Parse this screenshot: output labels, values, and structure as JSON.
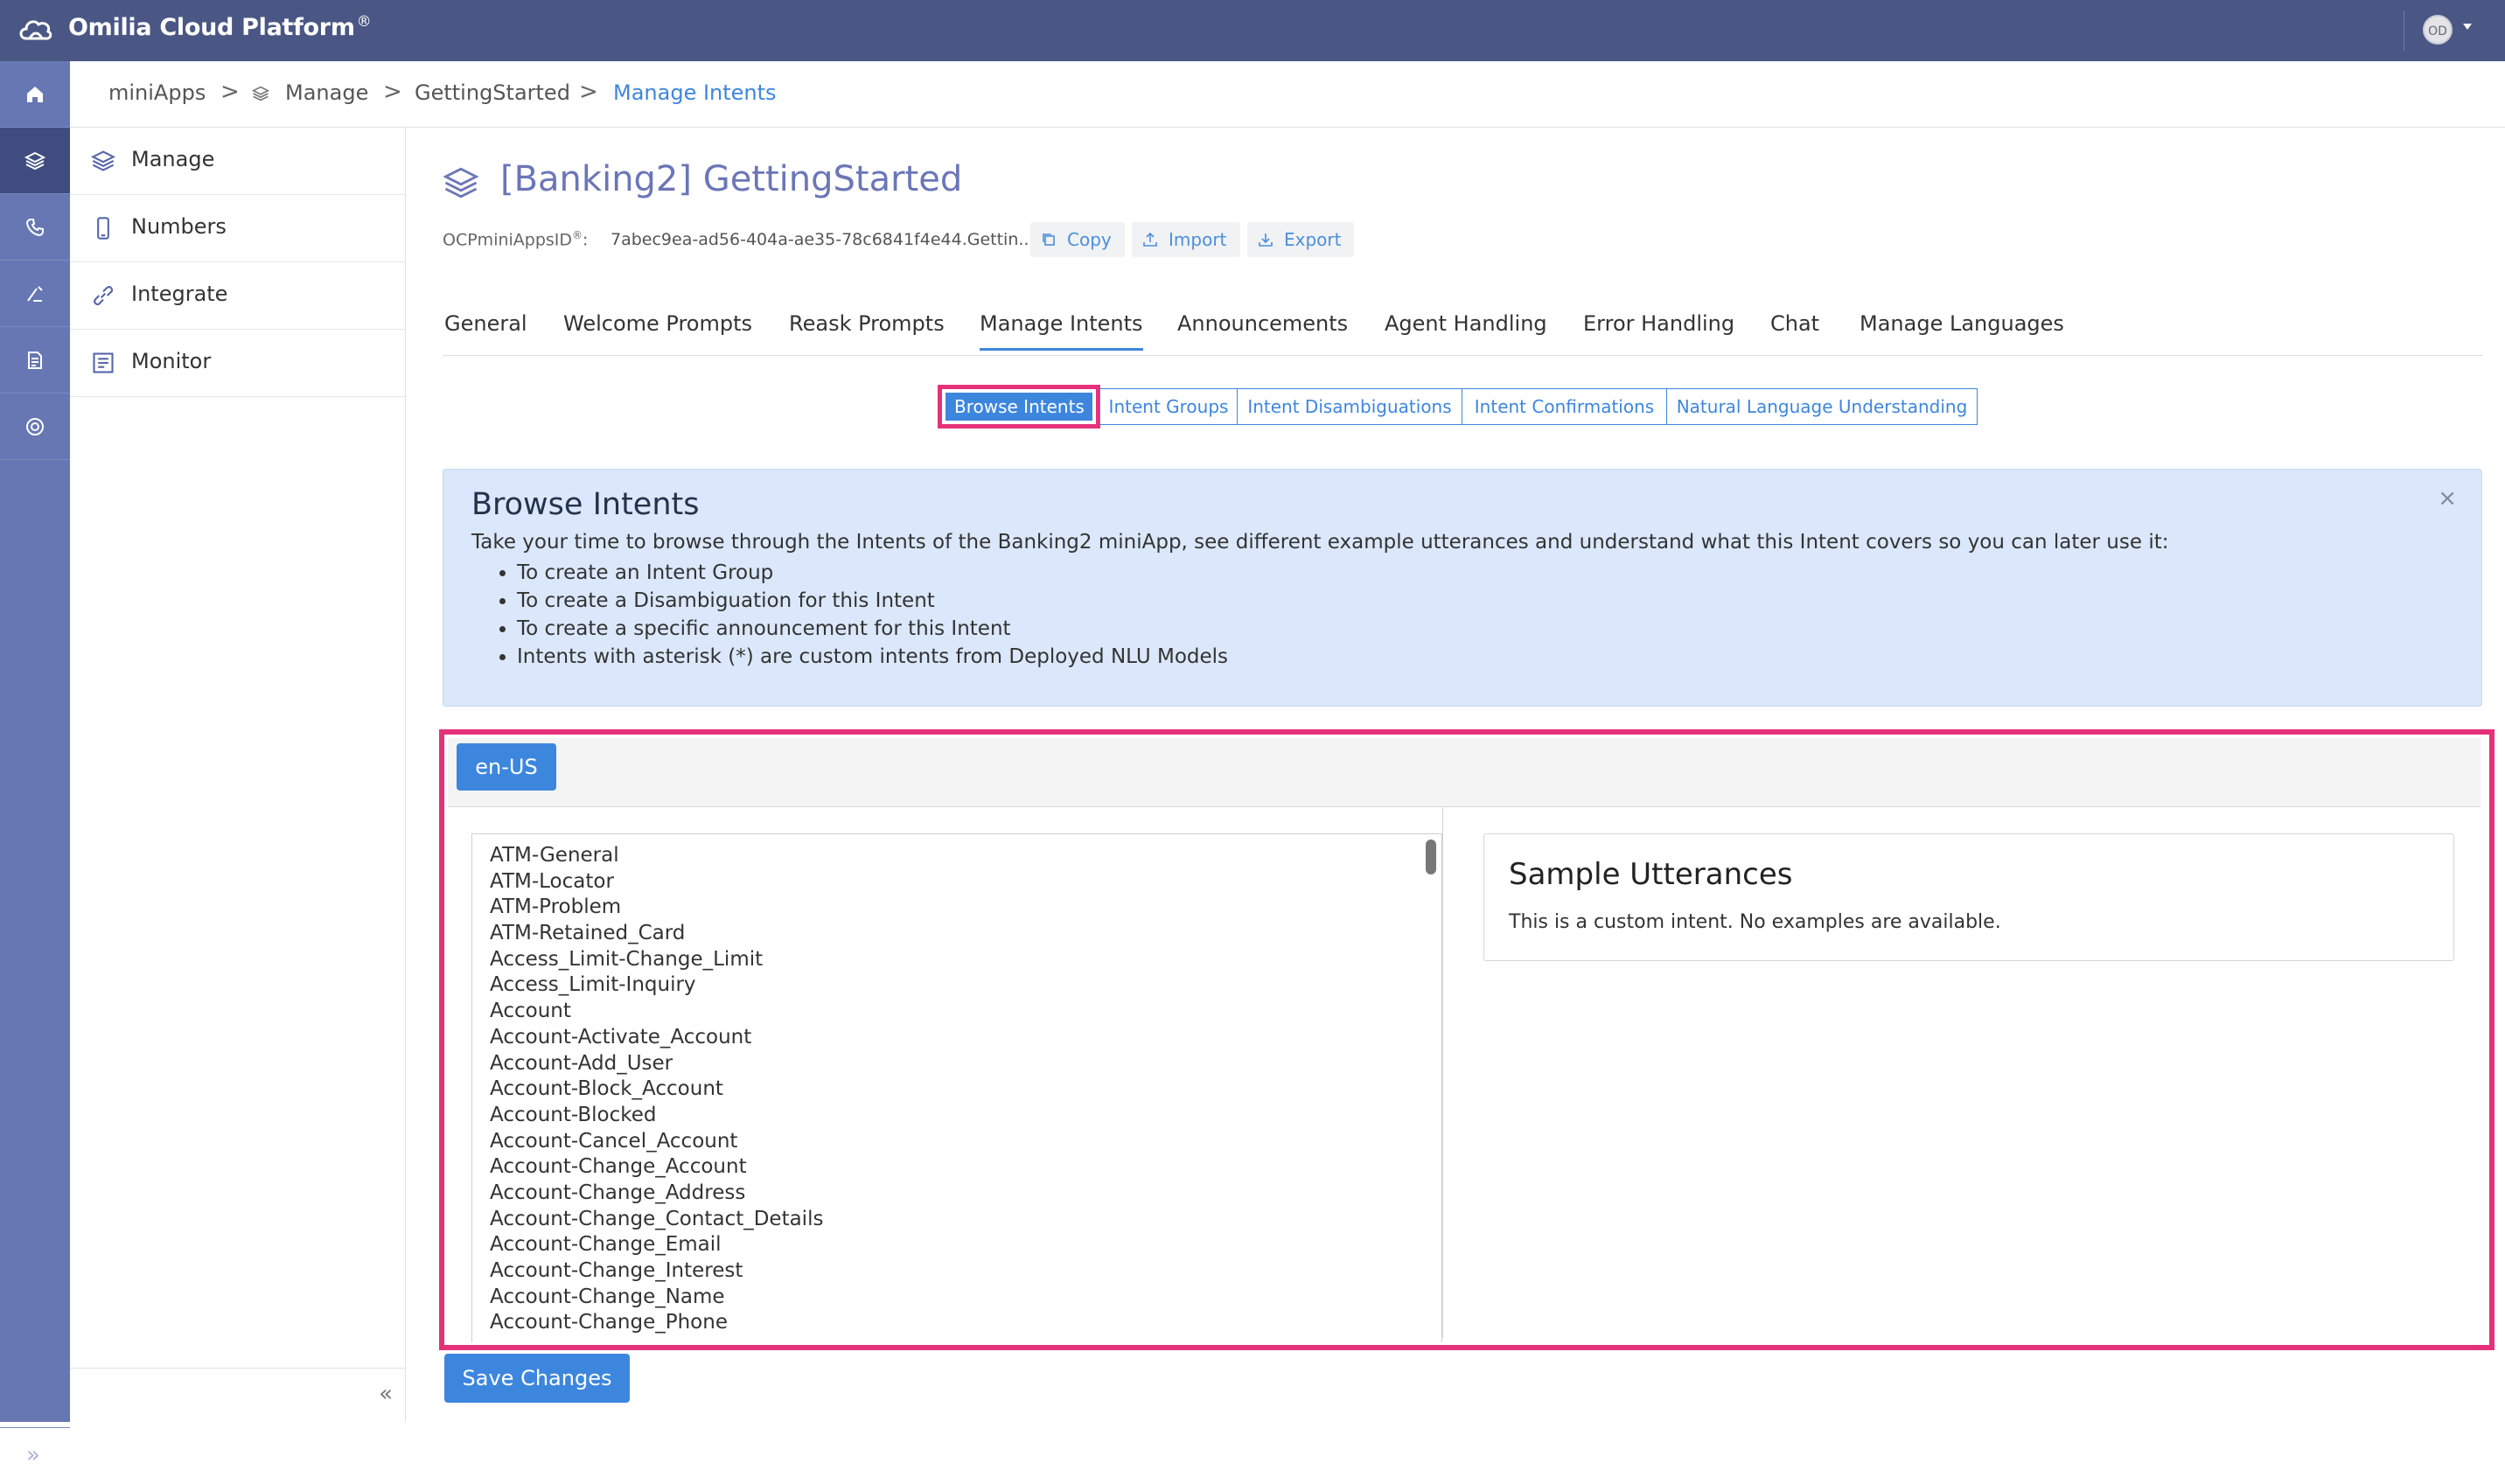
{
  "topbar": {
    "brand": "Omilia Cloud Platform",
    "brand_mark": "®",
    "avatar_initials": "OD"
  },
  "rail": {
    "icons": [
      "home-icon",
      "layers-icon",
      "phone-icon",
      "tools-icon",
      "document-icon",
      "support-icon"
    ],
    "active_index": 1
  },
  "breadcrumb": {
    "items": [
      "miniApps",
      "Manage",
      "GettingStarted",
      "Manage Intents"
    ],
    "separator": ">"
  },
  "sidemenu": {
    "items": [
      {
        "label": "Manage",
        "icon": "layers-icon"
      },
      {
        "label": "Numbers",
        "icon": "phone-icon"
      },
      {
        "label": "Integrate",
        "icon": "link-icon"
      },
      {
        "label": "Monitor",
        "icon": "monitor-icon"
      }
    ],
    "collapse_label": "«"
  },
  "header": {
    "title": "[Banking2] GettingStarted",
    "id_label": "OCPminiAppsID",
    "id_mark": "®",
    "id_suffix": ":",
    "id_value": "7abec9ea-ad56-404a-ae35-78c6841f4e44.Gettin...",
    "copy_label": "Copy",
    "import_label": "Import",
    "export_label": "Export"
  },
  "tabs": {
    "items": [
      "General",
      "Welcome Prompts",
      "Reask Prompts",
      "Manage Intents",
      "Announcements",
      "Agent Handling",
      "Error Handling",
      "Chat",
      "Manage Languages"
    ],
    "active": "Manage Intents"
  },
  "subtabs": {
    "items": [
      "Browse Intents",
      "Intent Groups",
      "Intent Disambiguations",
      "Intent Confirmations",
      "Natural Language Understanding"
    ],
    "active": "Browse Intents"
  },
  "info": {
    "title": "Browse Intents",
    "close": "×",
    "text": "Take your time to browse through the Intents of the Banking2 miniApp, see different example utterances and understand what this Intent covers so you can later use it:",
    "bullets": [
      "To create an Intent Group",
      "To create a Disambiguation for this Intent",
      "To create a specific announcement for this Intent",
      "Intents with asterisk (*) are custom intents from Deployed NLU Models"
    ]
  },
  "language": {
    "selected": "en-US"
  },
  "intents": [
    "ATM-General",
    "ATM-Locator",
    "ATM-Problem",
    "ATM-Retained_Card",
    "Access_Limit-Change_Limit",
    "Access_Limit-Inquiry",
    "Account",
    "Account-Activate_Account",
    "Account-Add_User",
    "Account-Block_Account",
    "Account-Blocked",
    "Account-Cancel_Account",
    "Account-Change_Account",
    "Account-Change_Address",
    "Account-Change_Contact_Details",
    "Account-Change_Email",
    "Account-Change_Interest",
    "Account-Change_Name",
    "Account-Change_Phone"
  ],
  "samples": {
    "title": "Sample Utterances",
    "text": "This is a custom intent. No examples are available."
  },
  "footer": {
    "save_label": "Save Changes"
  },
  "colors": {
    "topbar": "#4a5785",
    "rail": "#6677b3",
    "accent": "#3d86de",
    "highlight": "#e4317a",
    "info_bg": "#dbe8fb"
  }
}
